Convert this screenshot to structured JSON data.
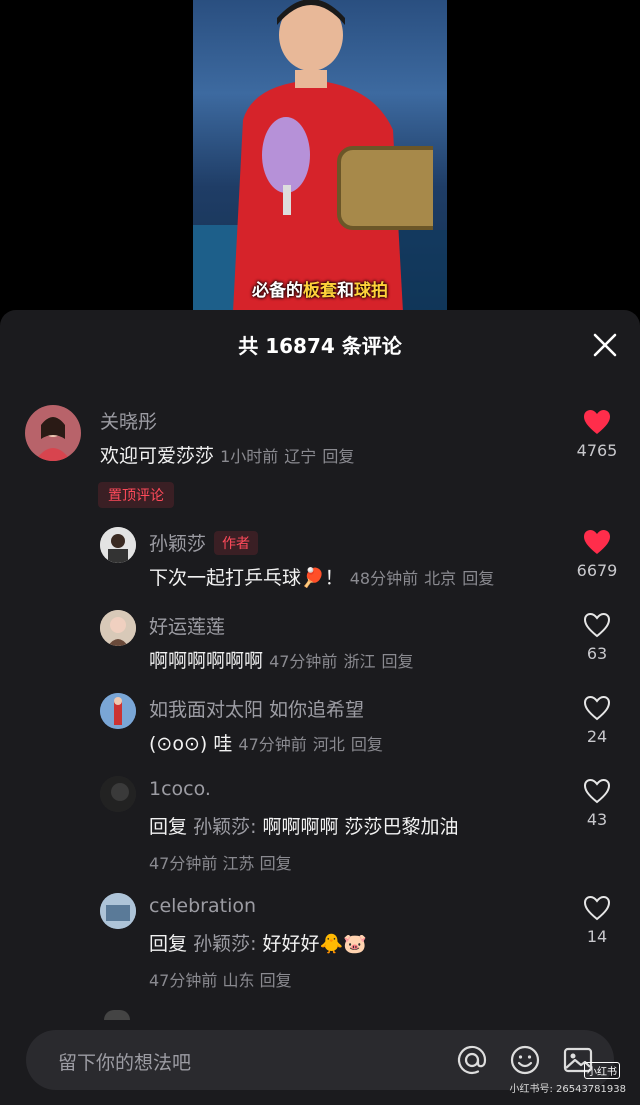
{
  "video": {
    "subtitle_prefix": "必备的",
    "subtitle_hl1": "板套",
    "subtitle_mid": "和",
    "subtitle_hl2": "球拍"
  },
  "sheet": {
    "title": "共 16874 条评论",
    "close_icon": "close-icon"
  },
  "comments": [
    {
      "name": "关晓彤",
      "text": "欢迎可爱莎莎",
      "time": "1小时前",
      "location": "辽宁",
      "reply": "回复",
      "likes": "4765",
      "liked": true,
      "pinned_label": "置顶评论"
    },
    {
      "name": "孙颖莎",
      "author_label": "作者",
      "text": "下次一起打乒乓球🏓！",
      "time": "48分钟前",
      "location": "北京",
      "reply": "回复",
      "likes": "6679",
      "liked": true
    },
    {
      "name": "好运莲莲",
      "text": "啊啊啊啊啊啊",
      "time": "47分钟前",
      "location": "浙江",
      "reply": "回复",
      "likes": "63",
      "liked": false
    },
    {
      "name": "如我面对太阳 如你追希望",
      "text": "(⊙o⊙) 哇",
      "time": "47分钟前",
      "location": "河北",
      "reply": "回复",
      "likes": "24",
      "liked": false
    },
    {
      "name": "1coco.",
      "reply_prefix": "回复",
      "reply_to": "孙颖莎:",
      "text": "啊啊啊啊 莎莎巴黎加油",
      "time": "47分钟前",
      "location": "江苏",
      "reply": "回复",
      "likes": "43",
      "liked": false
    },
    {
      "name": "celebration",
      "reply_prefix": "回复",
      "reply_to": "孙颖莎:",
      "text": "好好好🐥🐷",
      "time": "47分钟前",
      "location": "山东",
      "reply": "回复",
      "likes": "14",
      "liked": false
    }
  ],
  "input": {
    "placeholder": "留下你的想法吧",
    "icons": [
      "at-icon",
      "emoji-icon",
      "image-icon"
    ]
  },
  "watermark": {
    "logo": "小红书",
    "id_text": "小红书号: 26543781938"
  },
  "colors": {
    "accent_red": "#ff2d4b",
    "sheet_bg": "#1b1b1e",
    "highlight_yellow": "#ffd23a"
  }
}
